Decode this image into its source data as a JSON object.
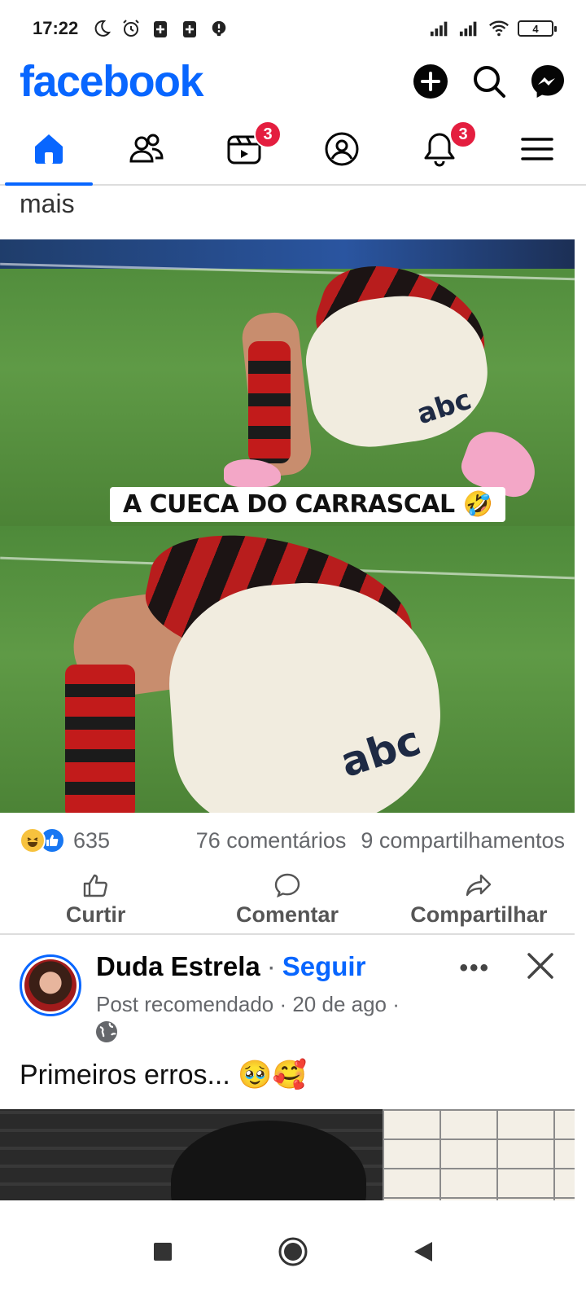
{
  "status_bar": {
    "time": "17:22",
    "battery": "4",
    "left_icons": [
      "moon-icon",
      "alarm-icon",
      "battery-saver-icon",
      "battery-saver-icon",
      "alert-icon"
    ],
    "right_icons": [
      "signal-icon",
      "signal-icon",
      "wifi-icon",
      "battery-icon"
    ]
  },
  "header": {
    "logo": "facebook",
    "brand_color": "#0866ff",
    "actions": [
      "plus-icon",
      "search-icon",
      "messenger-icon"
    ]
  },
  "tabs": [
    {
      "name": "home",
      "icon": "home-icon",
      "active": true,
      "badge": ""
    },
    {
      "name": "friends",
      "icon": "friends-icon",
      "active": false,
      "badge": ""
    },
    {
      "name": "video",
      "icon": "video-icon",
      "active": false,
      "badge": "3"
    },
    {
      "name": "profile",
      "icon": "profile-icon",
      "active": false,
      "badge": ""
    },
    {
      "name": "notifications",
      "icon": "bell-icon",
      "active": false,
      "badge": "3"
    },
    {
      "name": "menu",
      "icon": "menu-icon",
      "active": false,
      "badge": ""
    }
  ],
  "post1": {
    "text_tail": "mais",
    "caption": "A CUECA DO CARRASCAL 🤣",
    "sponsor_text": "abc",
    "reaction_count": "635",
    "comments": "76 comentários",
    "shares": "9 compartilhamentos",
    "actions": {
      "like": "Curtir",
      "comment": "Comentar",
      "share": "Compartilhar"
    }
  },
  "post2": {
    "author": "Duda Estrela",
    "separator": "·",
    "follow": "Seguir",
    "meta": "Post recomendado · 20 de ago ·",
    "text": "Primeiros erros... 🥹🥰",
    "more": "•••"
  },
  "colors": {
    "accent": "#0866ff",
    "badge": "#e41e3f",
    "secondary_text": "#65676b"
  }
}
